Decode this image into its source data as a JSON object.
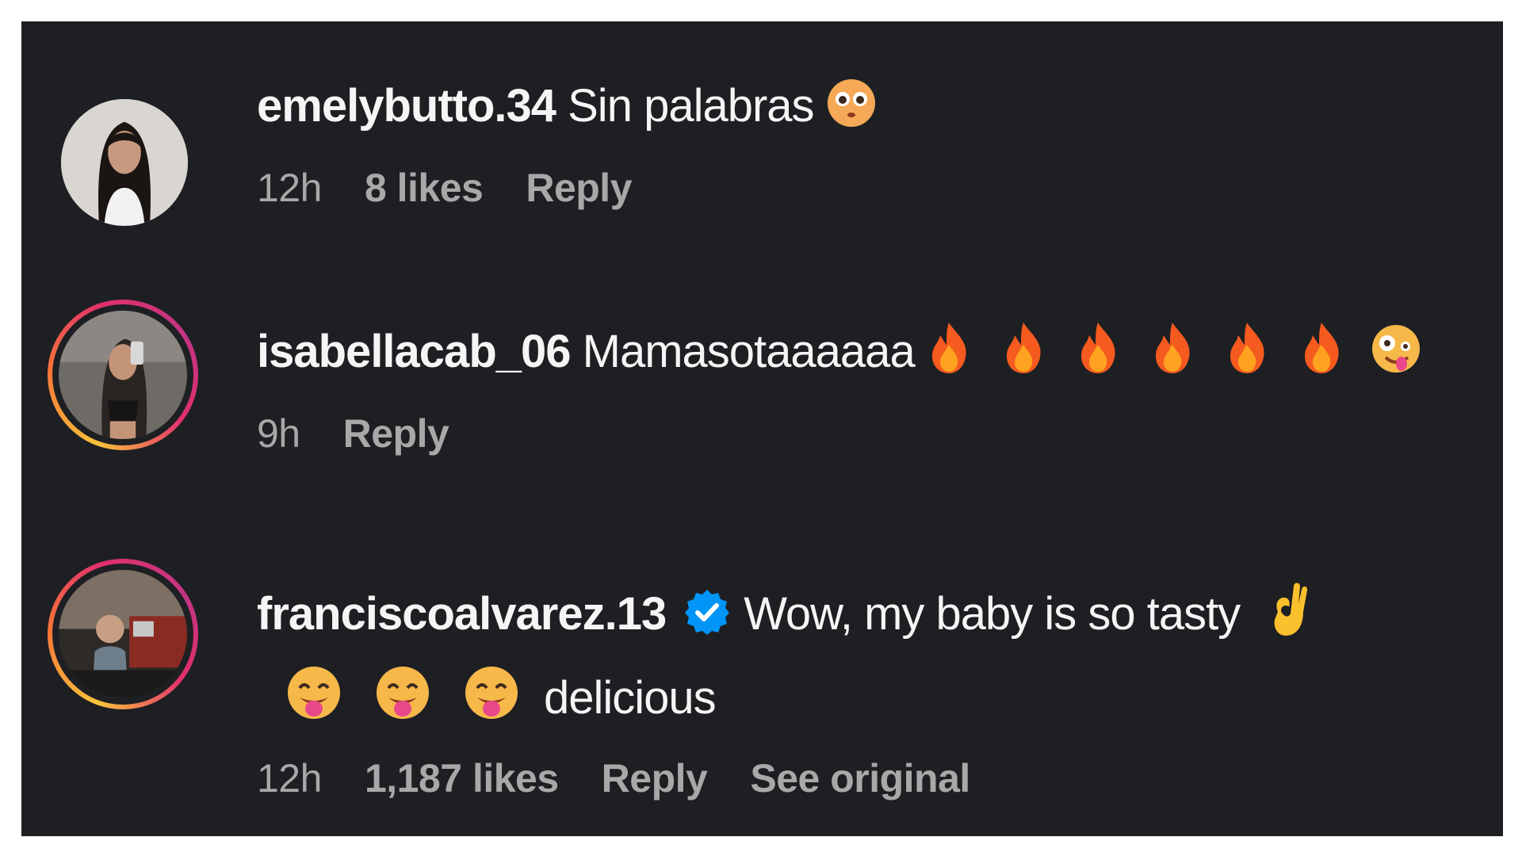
{
  "comments": [
    {
      "username": "emelybutto.34",
      "text": "Sin palabras",
      "emojis": [
        "flushed-face"
      ],
      "time": "12h",
      "likes": "8 likes",
      "reply": "Reply",
      "story_ring": false
    },
    {
      "username": "isabellacab_06",
      "text": "Mamasotaaaaaa",
      "emojis": [
        "fire",
        "fire",
        "fire",
        "fire",
        "fire",
        "fire",
        "zany-face"
      ],
      "time": "9h",
      "reply": "Reply",
      "story_ring": true
    },
    {
      "username": "franciscoalvarez.13",
      "verified": true,
      "text": "Wow, my baby is so tasty",
      "text_continued": "delicious",
      "emojis": [
        "ok-hand",
        "face-savoring-food",
        "face-savoring-food",
        "face-savoring-food"
      ],
      "time": "12h",
      "likes": "1,187 likes",
      "reply": "Reply",
      "see_original": "See original",
      "story_ring": true
    }
  ],
  "colors": {
    "background": "#1e1f23",
    "primary_text": "#f5f5f5",
    "secondary_text": "#a8a8a8",
    "verified_badge": "#0095f6"
  }
}
